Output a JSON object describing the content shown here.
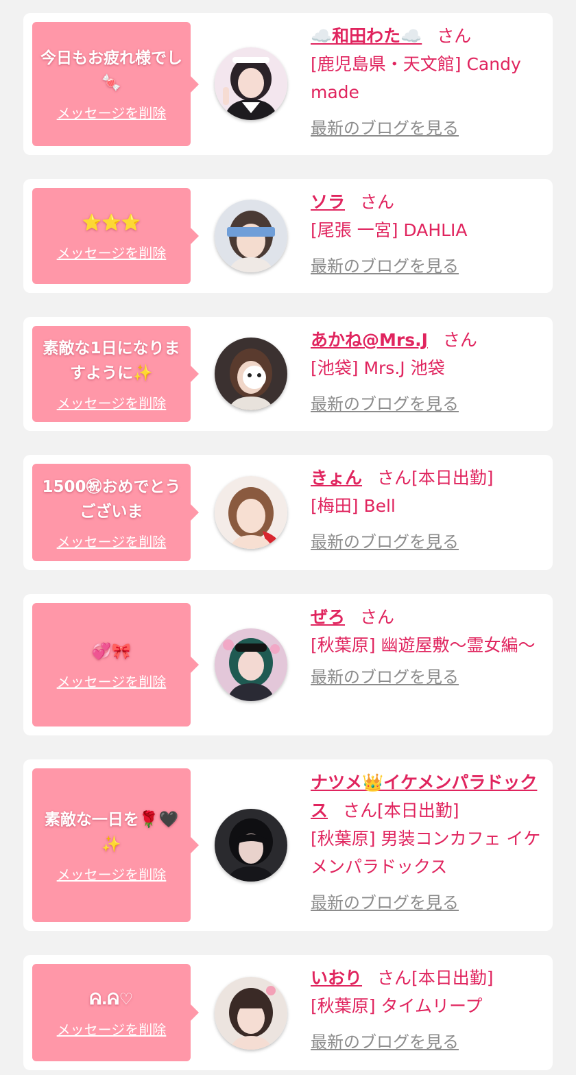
{
  "common": {
    "delete_label": "メッセージを削除",
    "blog_label": "最新のブログを見る",
    "san_label": "さん"
  },
  "colors": {
    "page_bg": "#f2f2f2",
    "bubble_bg": "#ff97a8",
    "accent": "#e0245e",
    "link_gray": "#8c8c8c"
  },
  "messages": [
    {
      "message": "今日もお疲れ様でし🍬",
      "name": "☁️和田わた☁️",
      "today": "",
      "shop": "[鹿児島県・天文館] Candy made",
      "avatar_icon": "girl-maid-photo"
    },
    {
      "message": "⭐⭐⭐",
      "name": "ソラ",
      "today": "",
      "shop": "[尾張 一宮] DAHLIA",
      "avatar_icon": "girl-photo"
    },
    {
      "message": "素敵な1日になりますように✨",
      "name": "あかね@Mrs.J",
      "today": "",
      "shop": "[池袋] Mrs.J 池袋",
      "avatar_icon": "girl-photo-with-panda-sticker"
    },
    {
      "message": "1500㊗おめでとうございま",
      "name": "きょん",
      "today": "[本日出勤]",
      "shop": "[梅田] Bell",
      "avatar_icon": "girl-photo"
    },
    {
      "message": "💞🎀",
      "name": "ぜろ",
      "today": "",
      "shop": "[秋葉原] 幽遊屋敷〜霊女編〜",
      "avatar_icon": "girl-green-hair-photo"
    },
    {
      "message": "素敵な一日を🌹🖤✨",
      "name": "ナツメ👑イケメンパラドックス",
      "today": "[本日出勤]",
      "shop": "[秋葉原] 男装コンカフェ イケメンパラドックス",
      "avatar_icon": "dark-hair-photo"
    },
    {
      "message": "ᕱ.ᕱ♡",
      "name": "いおり",
      "today": "[本日出勤]",
      "shop": "[秋葉原] タイムリープ",
      "avatar_icon": "girl-photo"
    }
  ]
}
